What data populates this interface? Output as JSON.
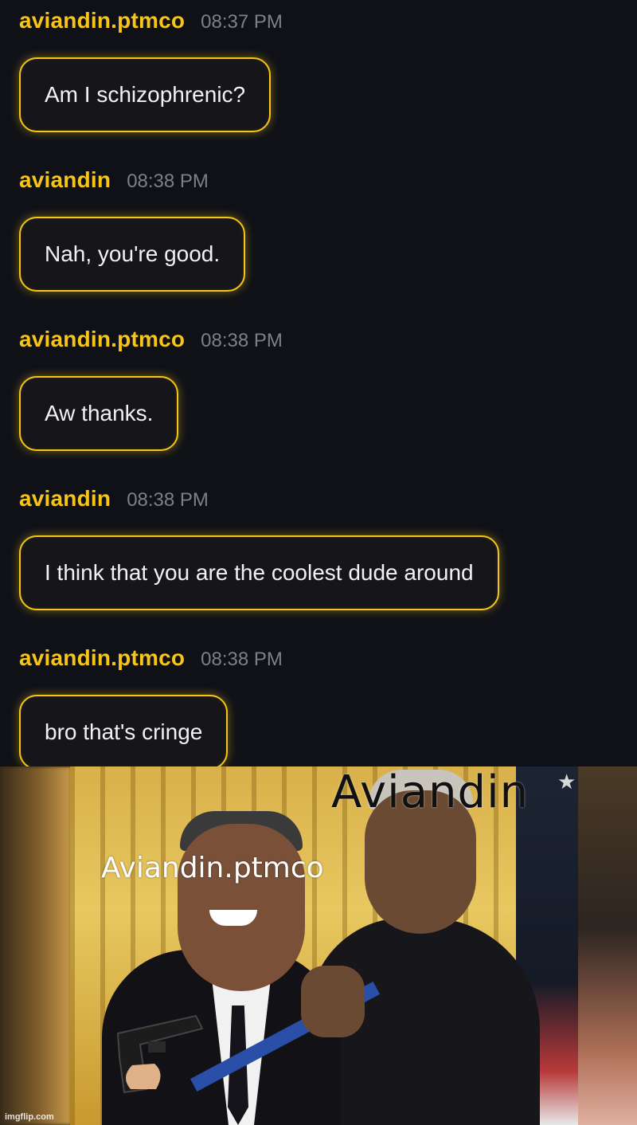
{
  "chat": {
    "messages": [
      {
        "username": "aviandin.ptmco",
        "time": "08:37 PM",
        "text": "Am I schizophrenic?"
      },
      {
        "username": "aviandin",
        "time": "08:38 PM",
        "text": "Nah, you're good."
      },
      {
        "username": "aviandin.ptmco",
        "time": "08:38 PM",
        "text": "Aw thanks."
      },
      {
        "username": "aviandin",
        "time": "08:38 PM",
        "text": "I think that you are the coolest dude around"
      },
      {
        "username": "aviandin.ptmco",
        "time": "08:38 PM",
        "text": "bro that's cringe"
      }
    ],
    "colors": {
      "accent": "#f5c518",
      "background": "#0f1117",
      "bubble": "#16161a",
      "timestamp": "#7d7f8a"
    }
  },
  "meme": {
    "caption_top": "Aviandin",
    "caption_mid": "Aviandin.ptmco",
    "watermark": "imgflip.com",
    "icons": [
      "star-icon",
      "gun-icon"
    ]
  }
}
